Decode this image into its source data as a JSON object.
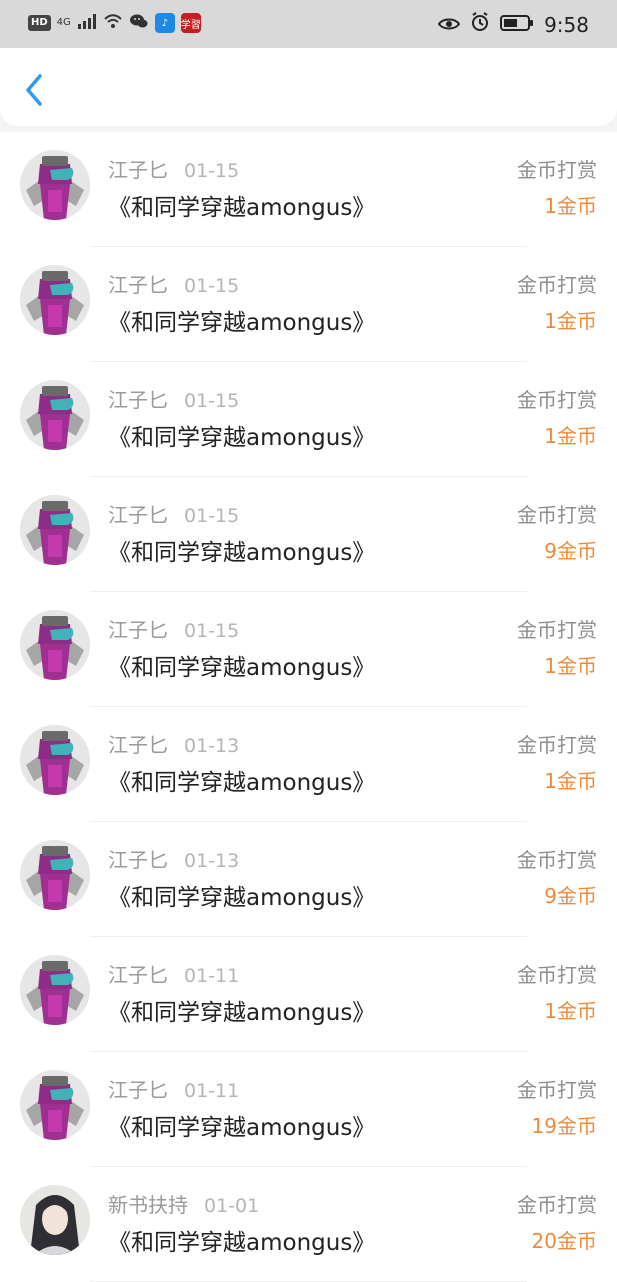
{
  "status_bar": {
    "network_label": "HD",
    "signal_label": "4G",
    "time": "9:58",
    "app_icon_red_text": "学習"
  },
  "nav": {
    "back_icon": "chevron-left-icon"
  },
  "list": [
    {
      "name": "江子匕",
      "date": "01-15",
      "title": "《和同学穿越amongus》",
      "type": "金币打赏",
      "amount": "1金币",
      "avatar": "purple-mask"
    },
    {
      "name": "江子匕",
      "date": "01-15",
      "title": "《和同学穿越amongus》",
      "type": "金币打赏",
      "amount": "1金币",
      "avatar": "purple-mask"
    },
    {
      "name": "江子匕",
      "date": "01-15",
      "title": "《和同学穿越amongus》",
      "type": "金币打赏",
      "amount": "1金币",
      "avatar": "purple-mask"
    },
    {
      "name": "江子匕",
      "date": "01-15",
      "title": "《和同学穿越amongus》",
      "type": "金币打赏",
      "amount": "9金币",
      "avatar": "purple-mask"
    },
    {
      "name": "江子匕",
      "date": "01-15",
      "title": "《和同学穿越amongus》",
      "type": "金币打赏",
      "amount": "1金币",
      "avatar": "purple-mask"
    },
    {
      "name": "江子匕",
      "date": "01-13",
      "title": "《和同学穿越amongus》",
      "type": "金币打赏",
      "amount": "1金币",
      "avatar": "purple-mask"
    },
    {
      "name": "江子匕",
      "date": "01-13",
      "title": "《和同学穿越amongus》",
      "type": "金币打赏",
      "amount": "9金币",
      "avatar": "purple-mask"
    },
    {
      "name": "江子匕",
      "date": "01-11",
      "title": "《和同学穿越amongus》",
      "type": "金币打赏",
      "amount": "1金币",
      "avatar": "purple-mask"
    },
    {
      "name": "江子匕",
      "date": "01-11",
      "title": "《和同学穿越amongus》",
      "type": "金币打赏",
      "amount": "19金币",
      "avatar": "purple-mask"
    },
    {
      "name": "新书扶持",
      "date": "01-01",
      "title": "《和同学穿越amongus》",
      "type": "金币打赏",
      "amount": "20金币",
      "avatar": "anime-portrait"
    }
  ],
  "colors": {
    "accent_blue": "#2b9af3",
    "amount_orange": "#f08a3b",
    "muted_text": "#9a9a9a"
  }
}
